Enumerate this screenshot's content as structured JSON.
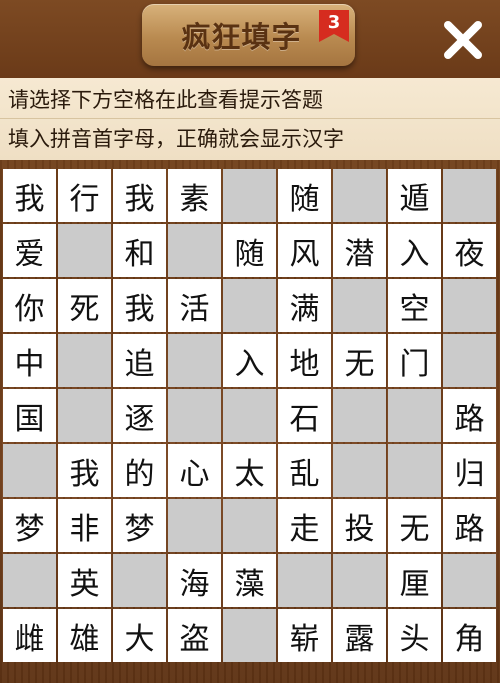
{
  "header": {
    "title": "疯狂填字",
    "level": "3",
    "close_icon": "close-icon"
  },
  "hints": {
    "line1": "请选择下方空格在此查看提示答题",
    "line2": "填入拼音首字母，正确就会显示汉字"
  },
  "colors": {
    "wood": "#6b3b17",
    "hint_bg": "#f4e6cc",
    "cell_filled": "#ffffff",
    "cell_empty": "#cbcbcb",
    "badge": "#d62c1f"
  },
  "board": {
    "rows": [
      [
        "我",
        "行",
        "我",
        "素",
        "",
        "随",
        "",
        "遁",
        ""
      ],
      [
        "爱",
        "",
        "和",
        "",
        "随",
        "风",
        "潜",
        "入",
        "夜"
      ],
      [
        "你",
        "死",
        "我",
        "活",
        "",
        "满",
        "",
        "空",
        ""
      ],
      [
        "中",
        "",
        "追",
        "",
        "入",
        "地",
        "无",
        "门",
        ""
      ],
      [
        "国",
        "",
        "逐",
        "",
        "",
        "石",
        "",
        "",
        "路"
      ],
      [
        "",
        "我",
        "的",
        "心",
        "太",
        "乱",
        "",
        "",
        "归"
      ],
      [
        "梦",
        "非",
        "梦",
        "",
        "",
        "走",
        "投",
        "无",
        "路"
      ],
      [
        "",
        "英",
        "",
        "海",
        "藻",
        "",
        "",
        "厘",
        ""
      ],
      [
        "雌",
        "雄",
        "大",
        "盗",
        "",
        "崭",
        "露",
        "头",
        "角"
      ]
    ]
  }
}
